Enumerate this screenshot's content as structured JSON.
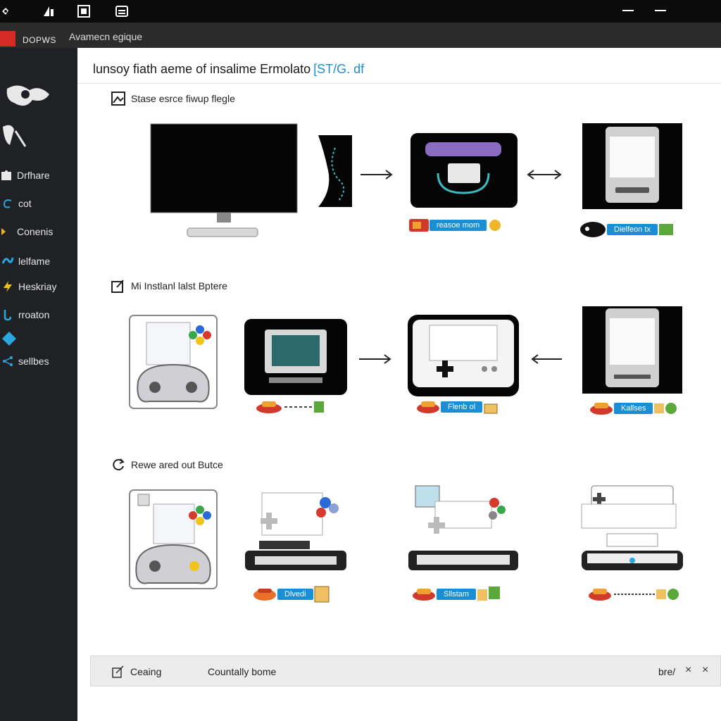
{
  "titlebar": {
    "icons": [
      "network-icon",
      "signal-icon",
      "image-icon",
      "window-icon"
    ]
  },
  "app": {
    "name": "DOPWS",
    "subtitle": "Avamecn egique"
  },
  "sidebar": {
    "items": [
      {
        "label": "",
        "icon": "splash-icon"
      },
      {
        "label": "",
        "icon": "brush-icon"
      },
      {
        "label": "Drfhare",
        "icon": "puzzle-icon"
      },
      {
        "label": "cot",
        "icon": "loop-icon"
      },
      {
        "label": "Conenis",
        "icon": "tool-icon"
      },
      {
        "label": "lelfame",
        "icon": "wave-icon"
      },
      {
        "label": "Heskriay",
        "icon": "bolt-icon"
      },
      {
        "label": "rroaton",
        "icon": "hook-icon"
      },
      {
        "label": "",
        "icon": "diamond-icon"
      },
      {
        "label": "sellbes",
        "icon": "share-icon"
      }
    ]
  },
  "main": {
    "title": "lunsoy fiath aeme of insalime Ermolato",
    "title_accent": "[ST/G. df"
  },
  "sections": [
    {
      "title": "Stase esrce fiwup flegle",
      "tags": [
        "reasoe mom",
        "Dielfeon tx"
      ]
    },
    {
      "title": "Mi Instlanl lalst Bptere",
      "tags": [
        "",
        "Flenb ol",
        "Kallses"
      ]
    },
    {
      "title": "Rewe ared out Butce",
      "tags": [
        "Dlvedi",
        "Sllstam",
        ""
      ]
    }
  ],
  "status": {
    "left": "Ceaing",
    "middle": "Countally bome",
    "right": "bre/",
    "close1": "×",
    "close2": "×"
  },
  "colors": {
    "accent": "#1a8fd6",
    "sidebar": "#1f2124",
    "titlebar": "#0b0b0b",
    "logo": "#d62b23"
  }
}
